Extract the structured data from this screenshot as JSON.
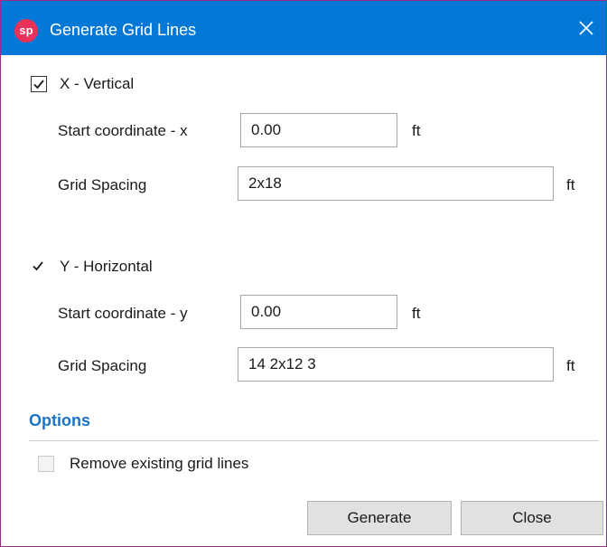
{
  "window": {
    "title": "Generate Grid Lines",
    "app_icon_text": "sp",
    "accent_color": "#0478d7"
  },
  "x_section": {
    "checkbox_label": "X - Vertical",
    "checked": true,
    "start_label": "Start coordinate - x",
    "start_value": "0.00",
    "start_unit": "ft",
    "spacing_label": "Grid Spacing",
    "spacing_value": "2x18",
    "spacing_unit": "ft"
  },
  "y_section": {
    "checkbox_label": "Y - Horizontal",
    "checked": true,
    "start_label": "Start coordinate - y",
    "start_value": "0.00",
    "start_unit": "ft",
    "spacing_label": "Grid Spacing",
    "spacing_value": "14 2x12 3",
    "spacing_unit": "ft"
  },
  "options": {
    "header": "Options",
    "remove_existing_label": "Remove existing grid lines",
    "remove_existing_checked": false
  },
  "buttons": {
    "generate": "Generate",
    "close": "Close"
  }
}
